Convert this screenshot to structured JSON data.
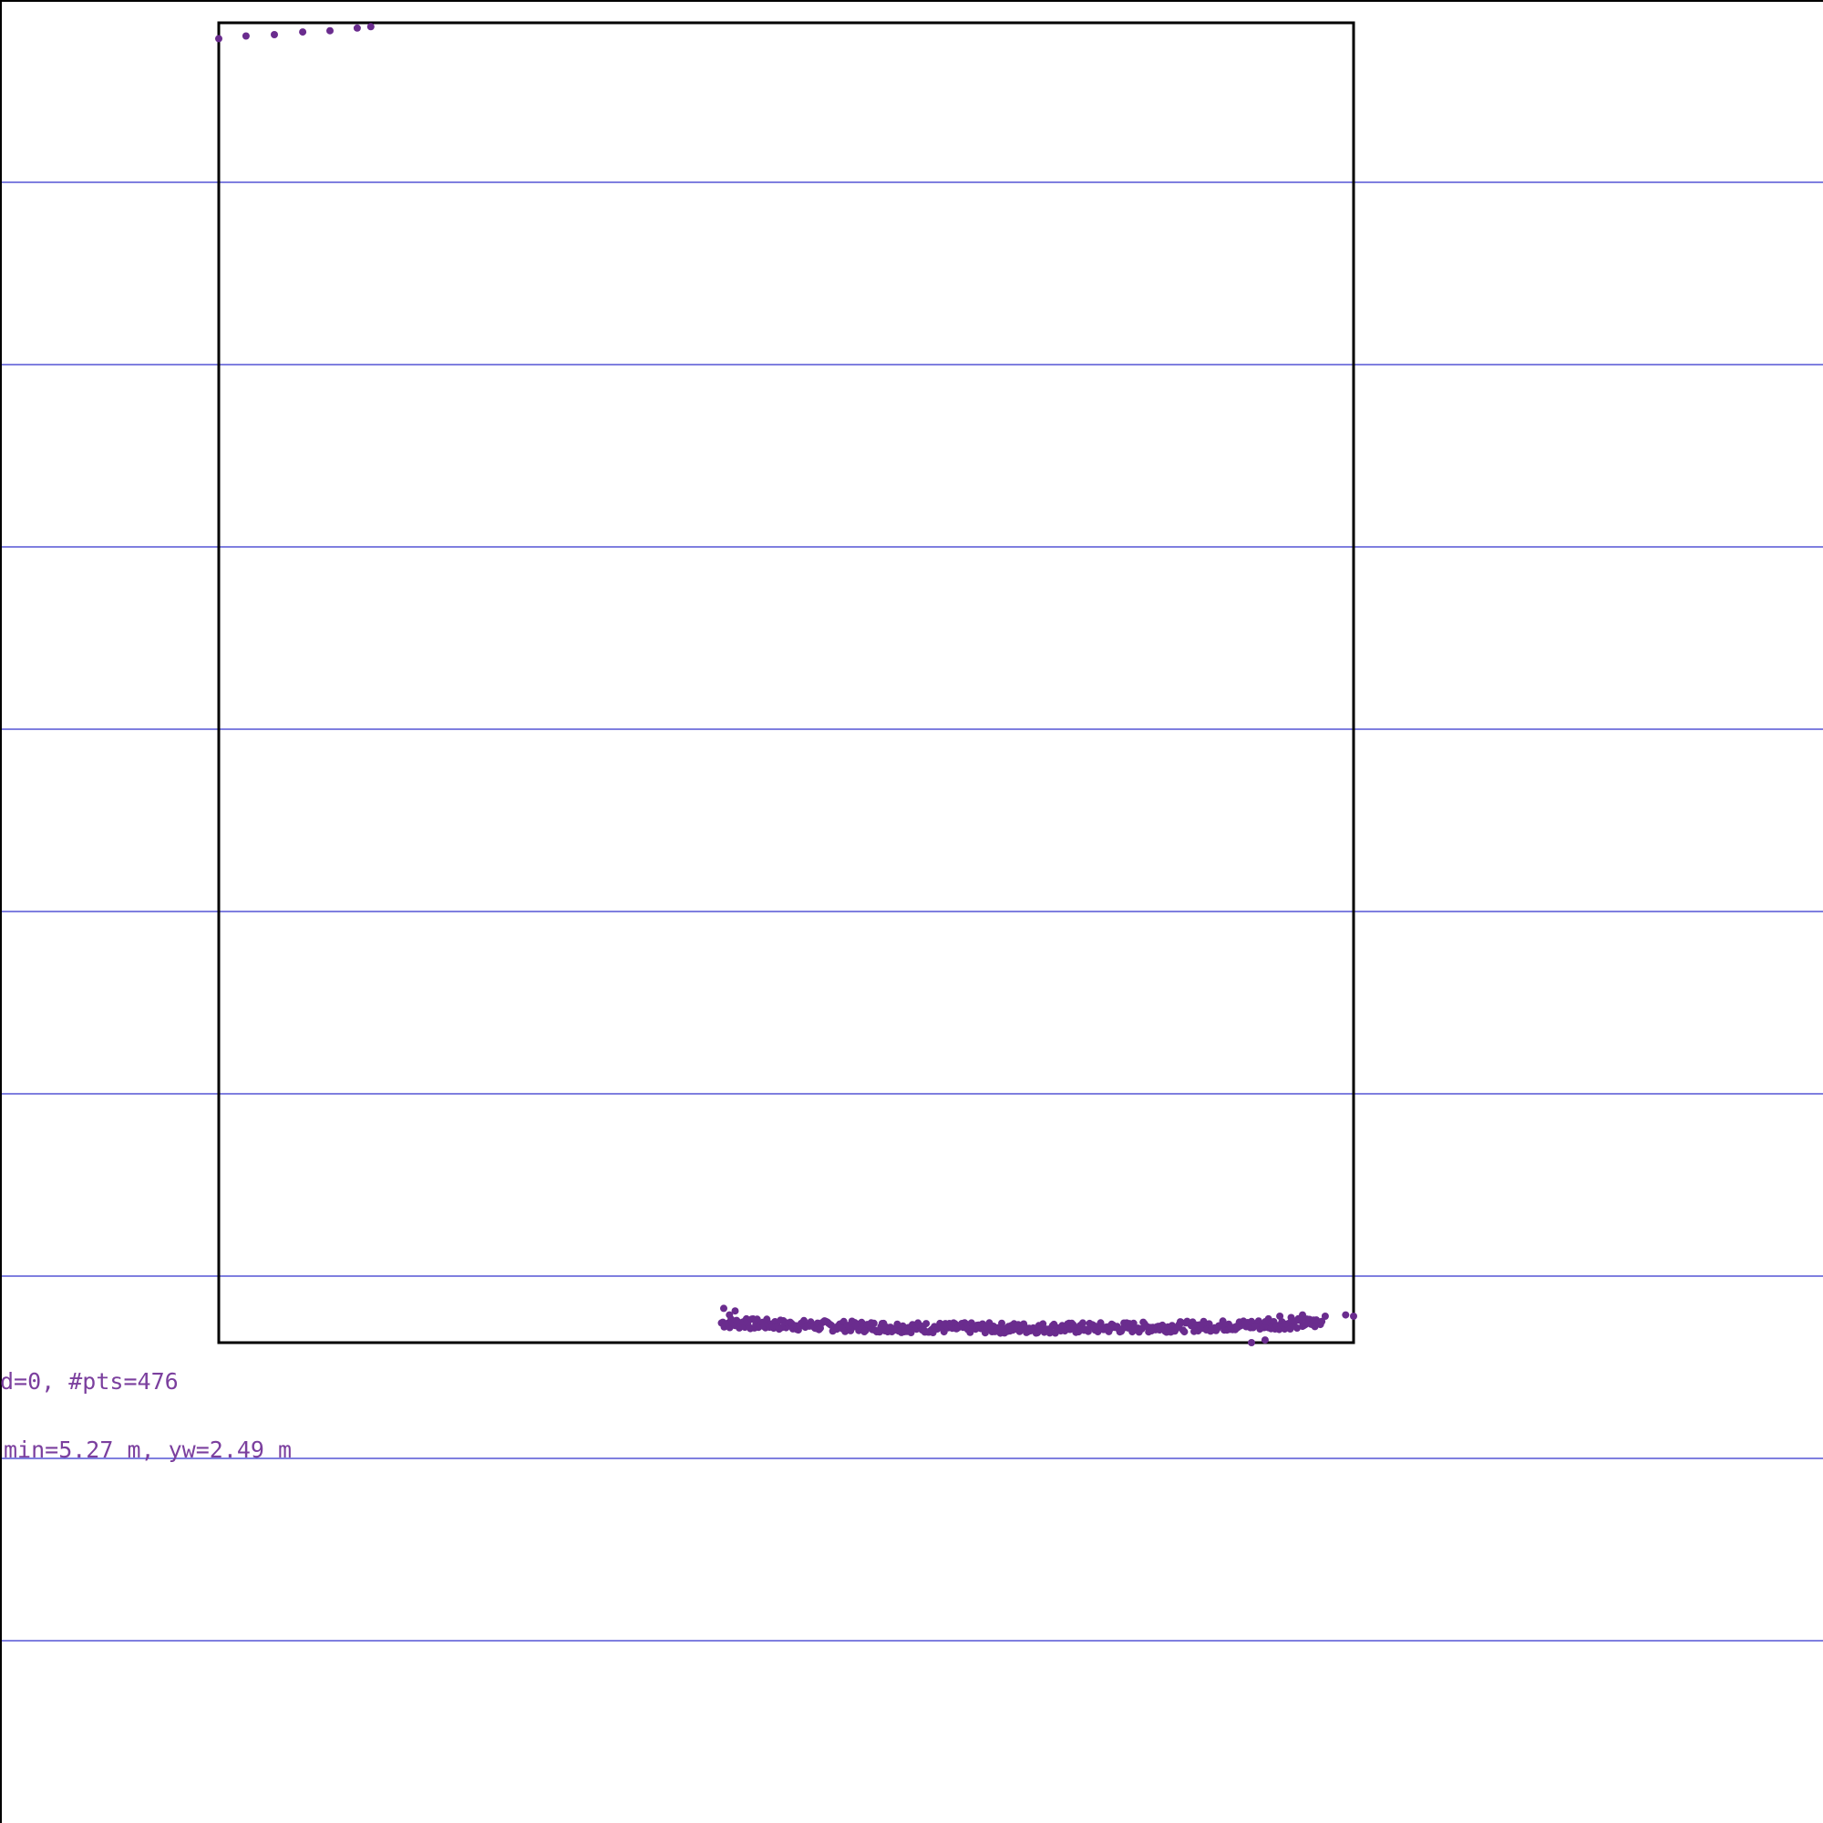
{
  "colors": {
    "background": "#ffffff",
    "frame": "#000000",
    "gridline": "#3333cc",
    "points": "#6a2c8e",
    "label": "#7b3f9e"
  },
  "labels": {
    "line1": "d=0, #pts=476",
    "line2": "min=5.27 m, yw=2.49 m"
  },
  "chart_data": {
    "type": "scatter",
    "title": "",
    "xlabel": "",
    "ylabel": "",
    "grid": true,
    "point_count": 476,
    "xlim": [
      0,
      1
    ],
    "ylim": [
      0,
      1
    ],
    "series": [
      {
        "name": "",
        "points": [
          [
            0.0,
            0.988
          ],
          [
            0.024,
            0.99
          ],
          [
            0.049,
            0.991
          ],
          [
            0.074,
            0.993
          ],
          [
            0.098,
            0.994
          ],
          [
            0.122,
            0.996
          ],
          [
            0.134,
            0.997
          ],
          [
            0.445,
            0.026
          ],
          [
            0.45,
            0.021
          ],
          [
            0.455,
            0.024
          ],
          [
            0.465,
            0.018
          ],
          [
            0.475,
            0.015
          ],
          [
            0.485,
            0.012
          ],
          [
            0.5,
            0.015
          ],
          [
            0.52,
            0.013
          ],
          [
            0.545,
            0.012
          ],
          [
            0.57,
            0.011
          ],
          [
            0.6,
            0.01
          ],
          [
            0.63,
            0.011
          ],
          [
            0.66,
            0.01
          ],
          [
            0.69,
            0.01
          ],
          [
            0.72,
            0.009
          ],
          [
            0.75,
            0.01
          ],
          [
            0.78,
            0.01
          ],
          [
            0.81,
            0.011
          ],
          [
            0.84,
            0.012
          ],
          [
            0.87,
            0.013
          ],
          [
            0.89,
            0.014
          ],
          [
            0.91,
            0.016
          ],
          [
            0.925,
            0.018
          ],
          [
            0.935,
            0.02
          ],
          [
            0.945,
            0.019
          ],
          [
            0.955,
            0.021
          ],
          [
            0.975,
            0.02
          ],
          [
            0.993,
            0.021
          ],
          [
            1.0,
            0.02
          ],
          [
            0.91,
            0.0
          ],
          [
            0.922,
            0.002
          ]
        ],
        "band": {
          "x_start": 0.443,
          "x_end": 0.972,
          "y_center": 0.011,
          "y_spread": 0.004,
          "count": 438
        }
      }
    ]
  }
}
